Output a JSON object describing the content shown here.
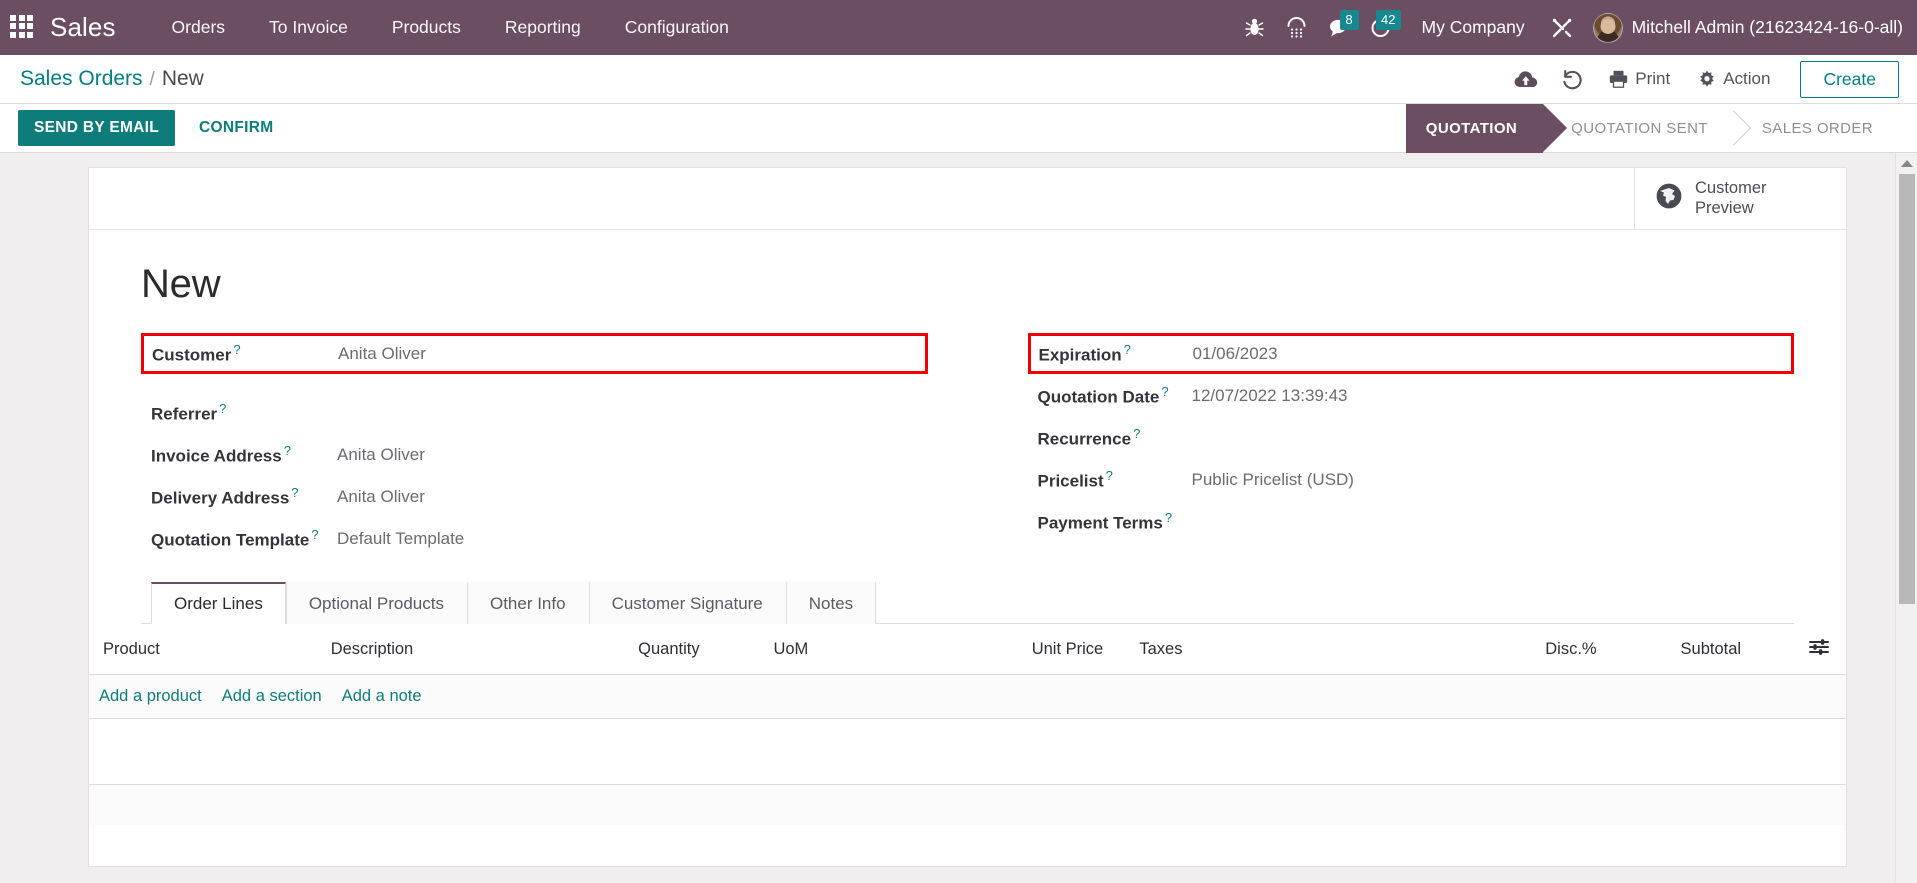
{
  "navbar": {
    "apps_icon": "apps-grid-icon",
    "brand": "Sales",
    "menu": [
      {
        "label": "Orders"
      },
      {
        "label": "To Invoice"
      },
      {
        "label": "Products"
      },
      {
        "label": "Reporting"
      },
      {
        "label": "Configuration"
      }
    ],
    "systray": {
      "debug_icon": "bug-icon",
      "voip_icon": "phone-keypad-icon",
      "messages_icon": "chat-bubble-icon",
      "messages_count": "8",
      "activities_icon": "clock-icon",
      "activities_count": "42",
      "company": "My Company",
      "tools_icon": "wrench-screwdriver-icon",
      "avatar": "user-avatar",
      "user": "Mitchell Admin (21623424-16-0-all)"
    },
    "accent": "#6b4e62",
    "badge_color": "#17888f"
  },
  "control_panel": {
    "breadcrumb": {
      "parent": "Sales Orders",
      "separator": "/",
      "current": "New"
    },
    "save_icon": "cloud-upload-icon",
    "discard_icon": "undo-icon",
    "print_icon": "printer-icon",
    "print_label": "Print",
    "action_icon": "gear-icon",
    "action_label": "Action",
    "create_label": "Create",
    "accent": "#017e84"
  },
  "statusbar_row": {
    "send_by_email_label": "SEND BY EMAIL",
    "confirm_label": "CONFIRM",
    "stages": [
      {
        "label": "QUOTATION",
        "active": true
      },
      {
        "label": "QUOTATION SENT",
        "active": false
      },
      {
        "label": "SALES ORDER",
        "active": false
      }
    ],
    "primary_color": "#0e7c7b"
  },
  "sheet": {
    "stat_button": {
      "icon": "globe-icon",
      "line1": "Customer",
      "line2": "Preview"
    },
    "record_title": "New",
    "left_fields": [
      {
        "label": "Customer",
        "tooltip": "?",
        "value": "Anita Oliver",
        "highlighted": true
      },
      {
        "label": "Referrer",
        "tooltip": "?",
        "value": "",
        "highlighted": false
      },
      {
        "label": "Invoice Address",
        "tooltip": "?",
        "value": "Anita Oliver",
        "highlighted": false
      },
      {
        "label": "Delivery Address",
        "tooltip": "?",
        "value": "Anita Oliver",
        "highlighted": false
      },
      {
        "label": "Quotation Template",
        "tooltip": "?",
        "value": "Default Template",
        "highlighted": false
      }
    ],
    "right_fields": [
      {
        "label": "Expiration",
        "tooltip": "?",
        "value": "01/06/2023",
        "highlighted": true
      },
      {
        "label": "Quotation Date",
        "tooltip": "?",
        "value": "12/07/2022 13:39:43",
        "highlighted": false
      },
      {
        "label": "Recurrence",
        "tooltip": "?",
        "value": "",
        "highlighted": false
      },
      {
        "label": "Pricelist",
        "tooltip": "?",
        "value": "Public Pricelist (USD)",
        "highlighted": false
      },
      {
        "label": "Payment Terms",
        "tooltip": "?",
        "value": "",
        "highlighted": false
      }
    ],
    "highlight_color": "#f00000",
    "notebook": {
      "tabs": [
        {
          "label": "Order Lines",
          "active": true
        },
        {
          "label": "Optional Products",
          "active": false
        },
        {
          "label": "Other Info",
          "active": false
        },
        {
          "label": "Customer Signature",
          "active": false
        },
        {
          "label": "Notes",
          "active": false
        }
      ],
      "columns": [
        {
          "label": "Product",
          "align": "left"
        },
        {
          "label": "Description",
          "align": "left"
        },
        {
          "label": "Quantity",
          "align": "left"
        },
        {
          "label": "UoM",
          "align": "left"
        },
        {
          "label": "Unit Price",
          "align": "left"
        },
        {
          "label": "Taxes",
          "align": "left"
        },
        {
          "label": "Disc.%",
          "align": "left"
        },
        {
          "label": "Subtotal",
          "align": "left"
        }
      ],
      "optional_columns_icon": "column-settings-icon",
      "rows": [],
      "add_links": [
        {
          "label": "Add a product"
        },
        {
          "label": "Add a section"
        },
        {
          "label": "Add a note"
        }
      ]
    }
  },
  "scrollbar": {
    "up_arrow_icon": "chevron-up-icon"
  }
}
